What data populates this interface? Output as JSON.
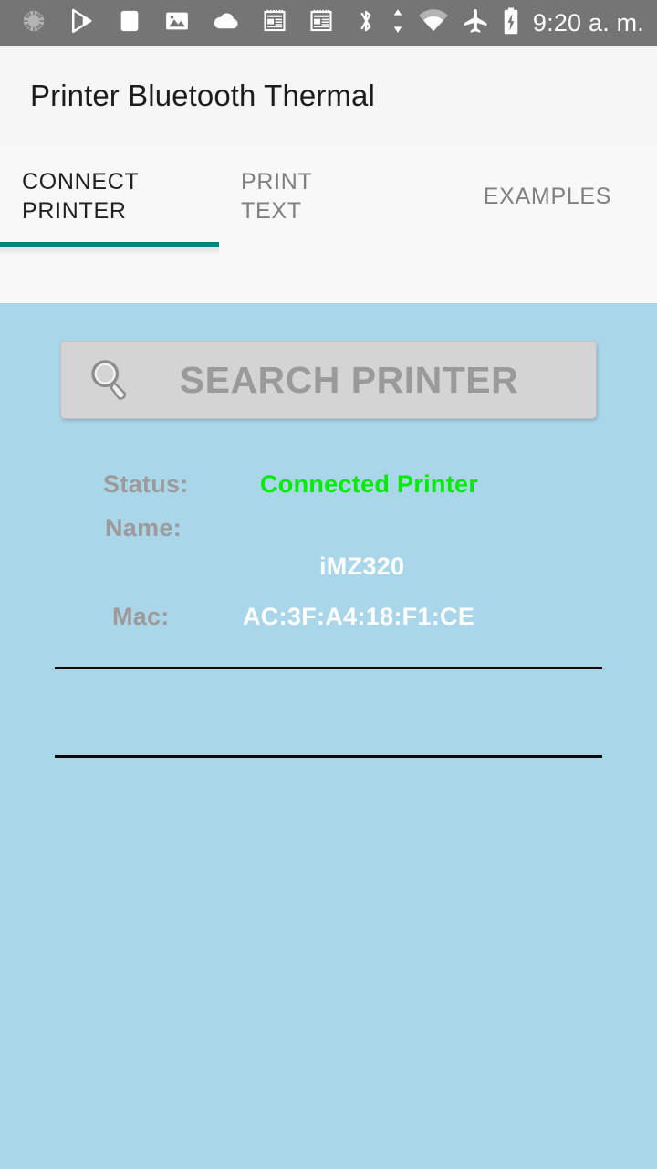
{
  "statusbar": {
    "background": "#757575",
    "clock": "9:20 a. m.",
    "left_icons": [
      {
        "name": "sync-spinner-icon",
        "label": "sync"
      },
      {
        "name": "google-play-icon",
        "label": "play store"
      },
      {
        "name": "white-square-icon",
        "label": "app"
      },
      {
        "name": "image-icon",
        "label": "photo"
      },
      {
        "name": "cloud-icon",
        "label": "cloud"
      },
      {
        "name": "news-article-icon",
        "label": "news 1"
      },
      {
        "name": "news-article-icon-2",
        "label": "news 2"
      }
    ],
    "right_icons": [
      {
        "name": "bluetooth-icon",
        "label": "bluetooth"
      },
      {
        "name": "data-transfer-icon",
        "label": "data up/down"
      },
      {
        "name": "wifi-icon",
        "label": "wifi"
      },
      {
        "name": "airplane-mode-icon",
        "label": "airplane mode"
      },
      {
        "name": "battery-charging-icon",
        "label": "battery charging"
      }
    ]
  },
  "header": {
    "title": "Printer Bluetooth Thermal",
    "background": "#f6f6f6",
    "title_color": "#1c1c1c"
  },
  "tabs": {
    "indicator_color": "#00837a",
    "active_index": 0,
    "items": [
      {
        "label": "CONNECT\nPRINTER",
        "active": true
      },
      {
        "label": "PRINT\nTEXT",
        "active": false
      },
      {
        "label": "EXAMPLES",
        "active": false
      }
    ]
  },
  "main": {
    "background": "#a9d6e8",
    "search_button": {
      "label": "SEARCH PRINTER",
      "icon": "magnifier-icon",
      "background": "#d4d4d4",
      "text_color": "#9a9a9a"
    },
    "info": {
      "rows": [
        {
          "label": "Status:",
          "value": "Connected Printer",
          "value_color": "#00ec00"
        },
        {
          "label": "Name:",
          "value": "iMZ320",
          "value_color": "#ffffff"
        },
        {
          "label": "Mac:",
          "value": "AC:3F:A4:18:F1:CE",
          "value_color": "#ffffff"
        }
      ],
      "label_color": "#9e9a9a",
      "divider_color": "#0a0a0a"
    }
  }
}
